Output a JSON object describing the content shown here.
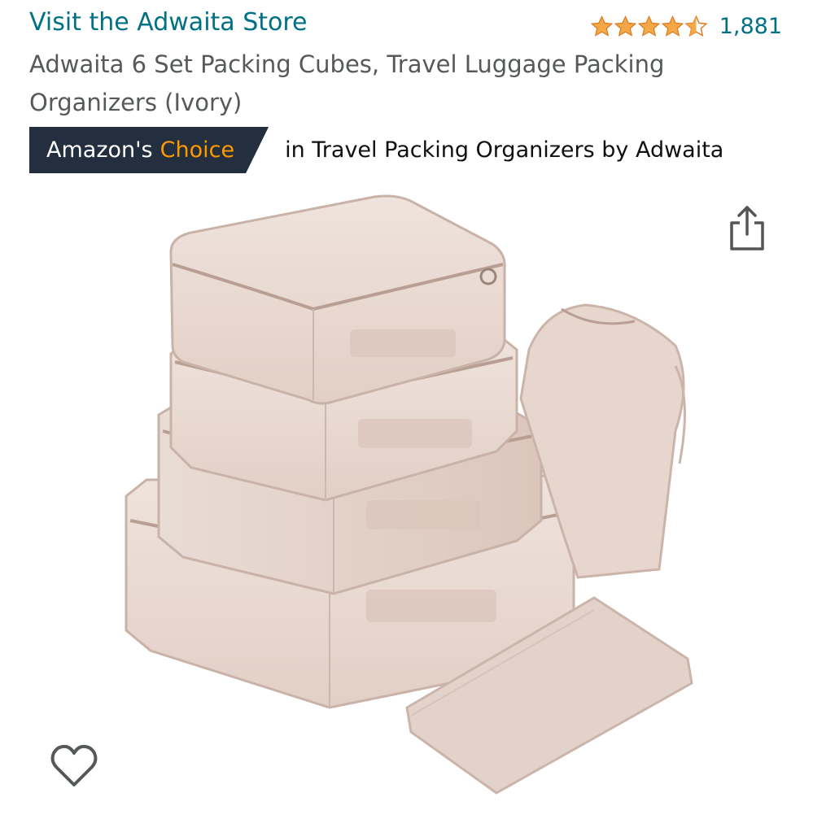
{
  "store_link": "Visit the Adwaita Store",
  "rating": {
    "stars": 4.5,
    "count": "1,881",
    "star_color": "#f3a847"
  },
  "title": "Adwaita 6 Set Packing Cubes, Travel Luggage Packing Organizers (Ivory)",
  "badge": {
    "label_prefix": "Amazon's",
    "label_highlight": "Choice",
    "context": "in Travel Packing Organizers by Adwaita",
    "bg_color": "#232f3e",
    "highlight_color": "#ff9900"
  },
  "icons": {
    "share": "share-icon",
    "wishlist": "heart-icon"
  }
}
